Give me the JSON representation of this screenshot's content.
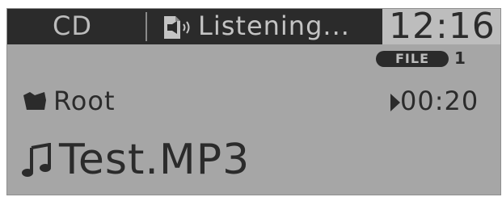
{
  "header": {
    "mode": "CD",
    "status": "Listening...",
    "clock": "12:16",
    "status_icon": "disc-speaker-icon"
  },
  "file_info": {
    "badge_label": "FILE",
    "number": "1"
  },
  "folder": {
    "icon": "folder-icon",
    "name": "Root"
  },
  "playback": {
    "state_icon": "play-icon",
    "elapsed": "00:20"
  },
  "track": {
    "icon": "music-note-icon",
    "name": "Test.MP3"
  },
  "colors": {
    "screen_bg": "#a6a6a6",
    "bar_bg": "#2b2b2b",
    "text_dark": "#2b2b2b",
    "text_light": "#c4c4c4",
    "clock_bg": "#bdbdbd"
  }
}
